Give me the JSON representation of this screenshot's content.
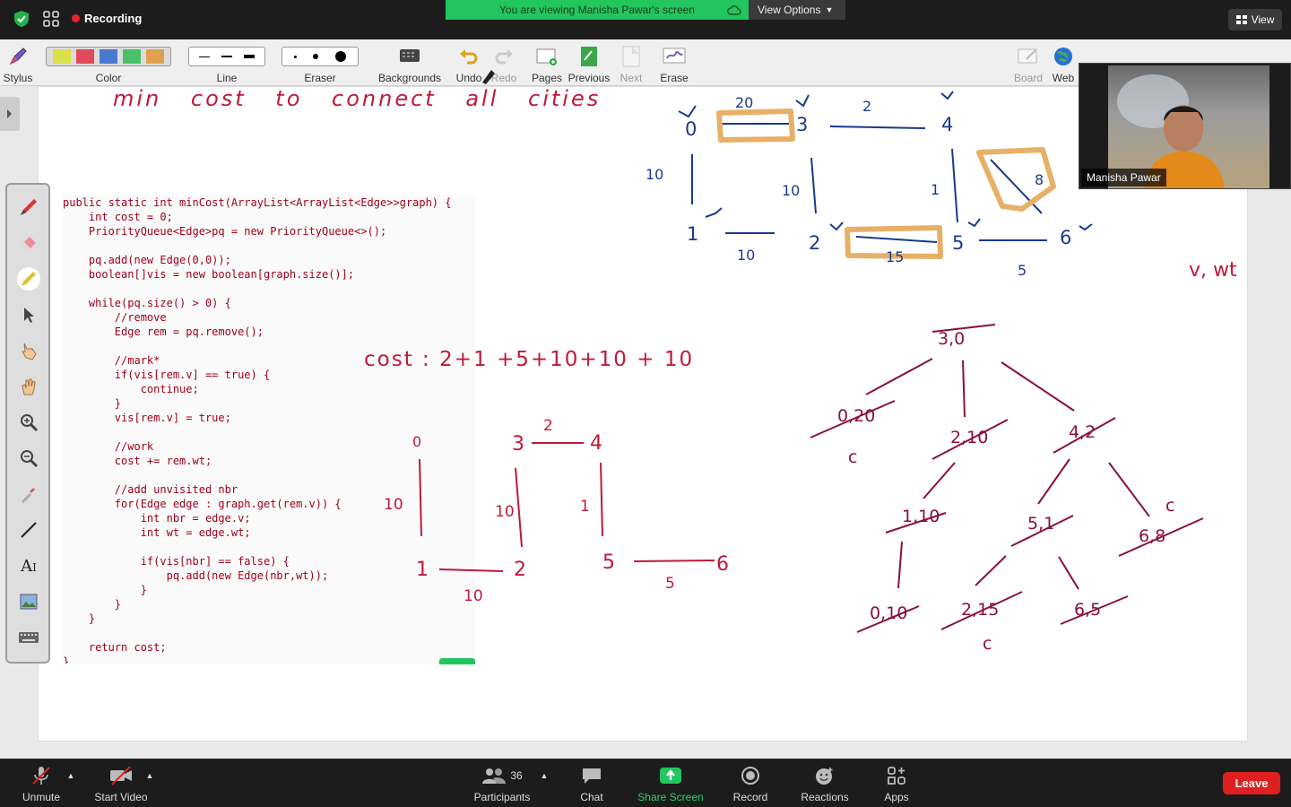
{
  "topbar": {
    "recording_label": "Recording",
    "banner_text": "You are viewing Manisha Pawar's screen",
    "view_options": "View Options",
    "view_button": "View"
  },
  "toolbar": {
    "stylus": "Stylus",
    "color": "Color",
    "line": "Line",
    "eraser": "Eraser",
    "backgrounds": "Backgrounds",
    "undo": "Undo",
    "redo": "Redo",
    "pages": "Pages",
    "previous": "Previous",
    "next": "Next",
    "erase": "Erase",
    "board": "Board",
    "web": "Web",
    "color_swatches": [
      "#d9e04a",
      "#e04a5a",
      "#4a7ad0",
      "#4ac06a",
      "#e0a050"
    ]
  },
  "annotations": {
    "heading": "min cost to connect all cities",
    "cost_formula": "cost : 2+1 +5+10+10 + 10",
    "vwt": "v, wt"
  },
  "graph_top": {
    "nodes": [
      "0",
      "3",
      "4",
      "1",
      "2",
      "5",
      "6"
    ],
    "edge_labels": [
      "20",
      "2",
      "10",
      "10",
      "1",
      "8",
      "10",
      "15",
      "5"
    ]
  },
  "graph_mst": {
    "nodes": [
      "3",
      "4",
      "1",
      "2",
      "5",
      "6"
    ],
    "edge_labels": [
      "2",
      "10",
      "10",
      "1",
      "5"
    ]
  },
  "tree": {
    "root": "3,0",
    "level1": [
      "0,20",
      "2,10",
      "4,2"
    ],
    "level1_marks": [
      "c"
    ],
    "level2": [
      "1,10",
      "5,1",
      "6,8"
    ],
    "level2_marks": [
      "c"
    ],
    "level3": [
      "0,10",
      "2,15",
      "6,5"
    ],
    "level3_marks": [
      "c"
    ]
  },
  "code": [
    "public static int minCost(ArrayList<ArrayList<Edge>>graph) {",
    "    int cost = 0;",
    "    PriorityQueue<Edge>pq = new PriorityQueue<>();",
    "",
    "    pq.add(new Edge(0,0));",
    "    boolean[]vis = new boolean[graph.size()];",
    "",
    "    while(pq.size() > 0) {",
    "        //remove",
    "        Edge rem = pq.remove();",
    "",
    "        //mark*",
    "        if(vis[rem.v] == true) {",
    "            continue;",
    "        }",
    "        vis[rem.v] = true;",
    "",
    "        //work",
    "        cost += rem.wt;",
    "",
    "        //add unvisited nbr",
    "        for(Edge edge : graph.get(rem.v)) {",
    "            int nbr = edge.v;",
    "            int wt = edge.wt;",
    "",
    "            if(vis[nbr] == false) {",
    "                pq.add(new Edge(nbr,wt));",
    "            }",
    "        }",
    "    }",
    "",
    "    return cost;",
    "}"
  ],
  "video": {
    "participant_name": "Manisha Pawar"
  },
  "bottombar": {
    "unmute": "Unmute",
    "start_video": "Start Video",
    "participants": "Participants",
    "participant_count": "36",
    "chat": "Chat",
    "share_screen": "Share Screen",
    "record": "Record",
    "reactions": "Reactions",
    "apps": "Apps",
    "leave": "Leave"
  }
}
